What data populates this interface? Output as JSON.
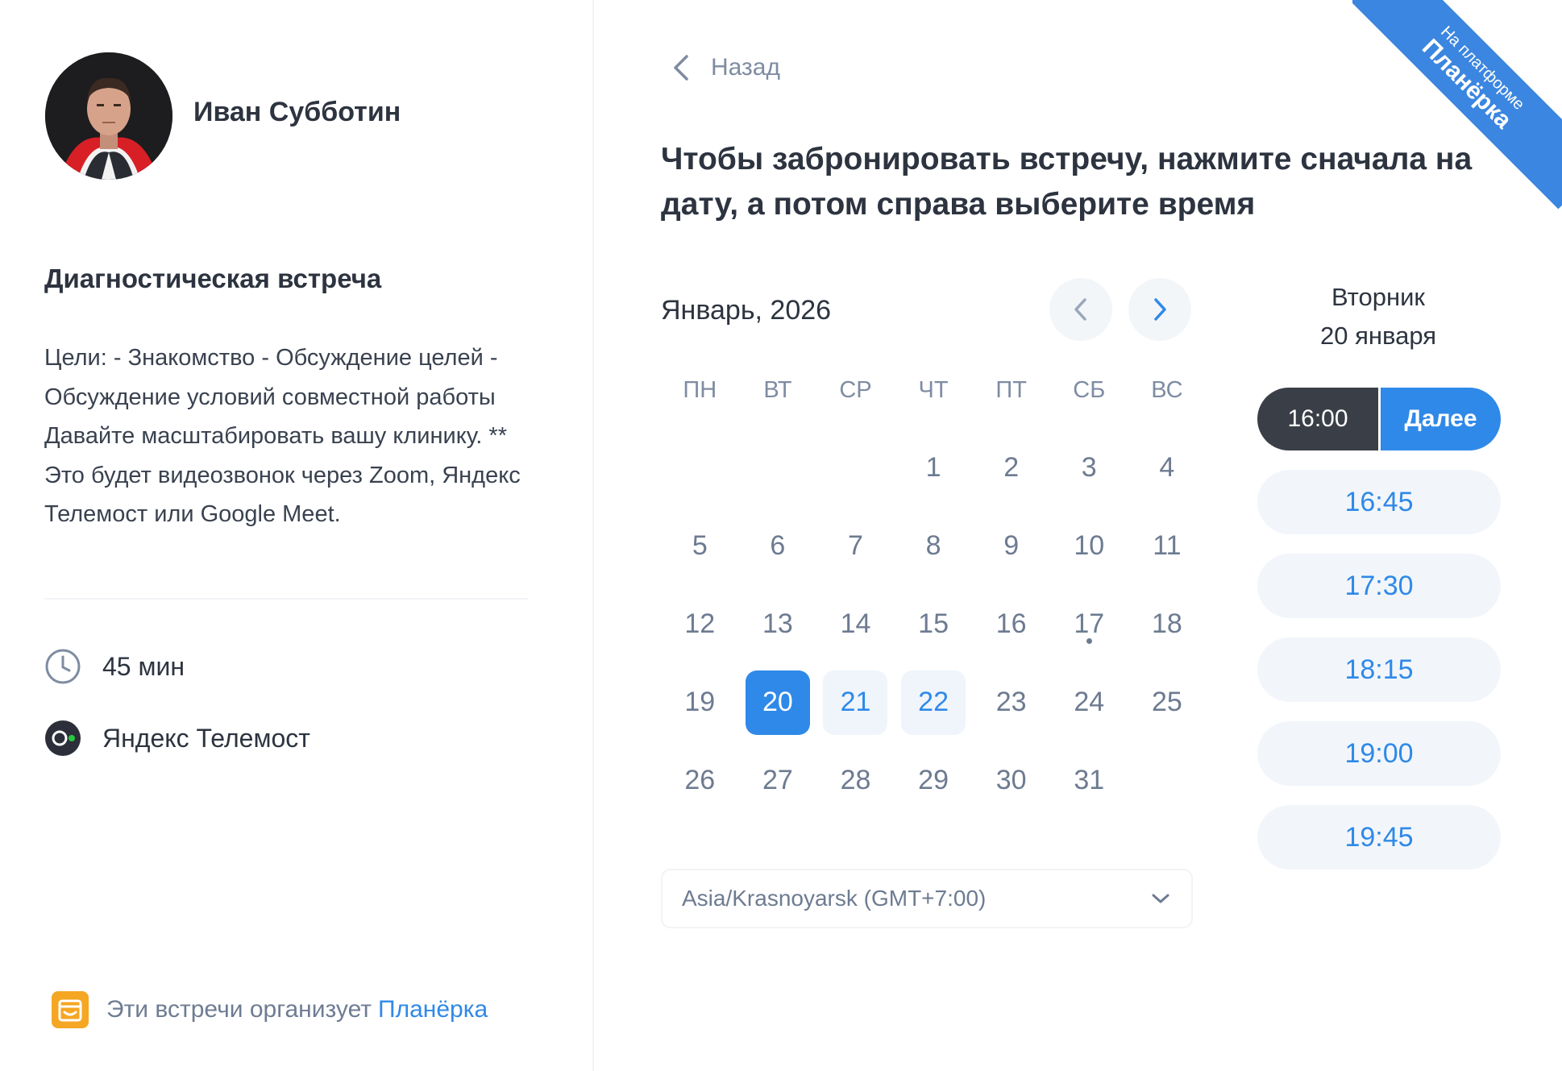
{
  "host": {
    "name": "Иван Субботин"
  },
  "event": {
    "title": "Диагностическая встреча",
    "description": "Цели: - Знакомство - Обсуждение целей - Обсуждение условий совместной работы Давайте масштабировать вашу клинику. ** Это будет видеозвонок через Zoom, Яндекс Телемост или Google Meet.",
    "duration": "45 мин",
    "location": "Яндекс Телемост"
  },
  "footer": {
    "text": "Эти встречи организует",
    "brand": "Планёрка"
  },
  "ribbon": {
    "small": "На платформе",
    "big": "Планёрка"
  },
  "nav": {
    "back_label": "Назад"
  },
  "heading": "Чтобы забронировать встречу, нажмите сначала на дату, а потом справа выберите время",
  "calendar": {
    "month_label": "Январь, 2026",
    "weekdays": [
      "ПН",
      "ВТ",
      "СР",
      "ЧТ",
      "ПТ",
      "СБ",
      "ВС"
    ],
    "days": [
      {
        "d": "",
        "s": "empty"
      },
      {
        "d": "",
        "s": "empty"
      },
      {
        "d": "",
        "s": "empty"
      },
      {
        "d": "1",
        "s": "disabled"
      },
      {
        "d": "2",
        "s": "disabled"
      },
      {
        "d": "3",
        "s": "disabled"
      },
      {
        "d": "4",
        "s": "disabled"
      },
      {
        "d": "5",
        "s": "disabled"
      },
      {
        "d": "6",
        "s": "disabled"
      },
      {
        "d": "7",
        "s": "disabled"
      },
      {
        "d": "8",
        "s": "disabled"
      },
      {
        "d": "9",
        "s": "disabled"
      },
      {
        "d": "10",
        "s": "disabled"
      },
      {
        "d": "11",
        "s": "disabled"
      },
      {
        "d": "12",
        "s": "disabled"
      },
      {
        "d": "13",
        "s": "disabled"
      },
      {
        "d": "14",
        "s": "disabled"
      },
      {
        "d": "15",
        "s": "disabled"
      },
      {
        "d": "16",
        "s": "disabled"
      },
      {
        "d": "17",
        "s": "today"
      },
      {
        "d": "18",
        "s": "disabled"
      },
      {
        "d": "19",
        "s": "disabled"
      },
      {
        "d": "20",
        "s": "selected"
      },
      {
        "d": "21",
        "s": "available"
      },
      {
        "d": "22",
        "s": "available"
      },
      {
        "d": "23",
        "s": "disabled"
      },
      {
        "d": "24",
        "s": "disabled"
      },
      {
        "d": "25",
        "s": "disabled"
      },
      {
        "d": "26",
        "s": "disabled"
      },
      {
        "d": "27",
        "s": "disabled"
      },
      {
        "d": "28",
        "s": "disabled"
      },
      {
        "d": "29",
        "s": "disabled"
      },
      {
        "d": "30",
        "s": "disabled"
      },
      {
        "d": "31",
        "s": "disabled"
      }
    ],
    "timezone": "Asia/Krasnoyarsk (GMT+7:00)"
  },
  "slots": {
    "weekday": "Вторник",
    "date": "20 января",
    "selected_time": "16:00",
    "next_label": "Далее",
    "times": [
      "16:45",
      "17:30",
      "18:15",
      "19:00",
      "19:45"
    ]
  },
  "colors": {
    "accent": "#2f89e8",
    "dark": "#3a3f47",
    "available_bg": "#eff5fb",
    "footer_icon": "#f5a623",
    "telemost_dot": "#27c93f"
  }
}
